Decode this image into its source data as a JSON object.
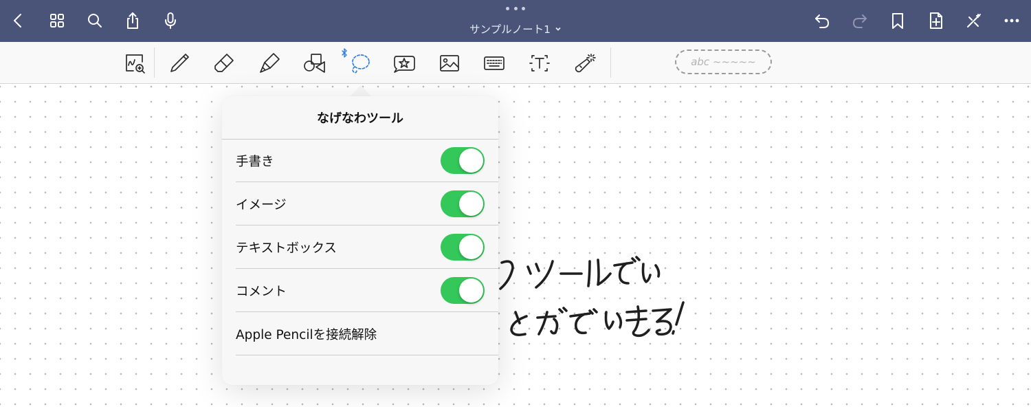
{
  "navbar": {
    "document_title": "サンプルノート1",
    "title_chevron": "chevron-down-icon",
    "left_icons": [
      "back-chevron-icon",
      "grid-icon",
      "search-icon",
      "share-icon",
      "microphone-icon"
    ],
    "right_icons": [
      "undo-icon",
      "redo-icon",
      "bookmark-icon",
      "add-page-icon",
      "close-sparkle-icon",
      "more-icon"
    ],
    "background_color": "#4a5479"
  },
  "toolbar": {
    "tools": [
      "zoom-window-icon",
      "pen-icon",
      "eraser-icon",
      "highlighter-icon",
      "shapes-icon",
      "lasso-icon",
      "sticker-icon",
      "image-icon",
      "keyboard-icon",
      "text-box-icon",
      "laser-pointer-icon"
    ],
    "active_tool": "lasso-icon",
    "handwriting_pill_text": "abc ~~~~~"
  },
  "popover": {
    "title": "なげなわツール",
    "options": [
      {
        "label": "手書き",
        "enabled": true
      },
      {
        "label": "イメージ",
        "enabled": true
      },
      {
        "label": "テキストボックス",
        "enabled": true
      },
      {
        "label": "コメント",
        "enabled": true
      }
    ],
    "action_label": "Apple Pencilを接続解除",
    "toggle_on_color": "#34c759"
  },
  "canvas": {
    "handwritten_line_1": "のツールでい",
    "handwritten_line_2": "とができる!"
  }
}
